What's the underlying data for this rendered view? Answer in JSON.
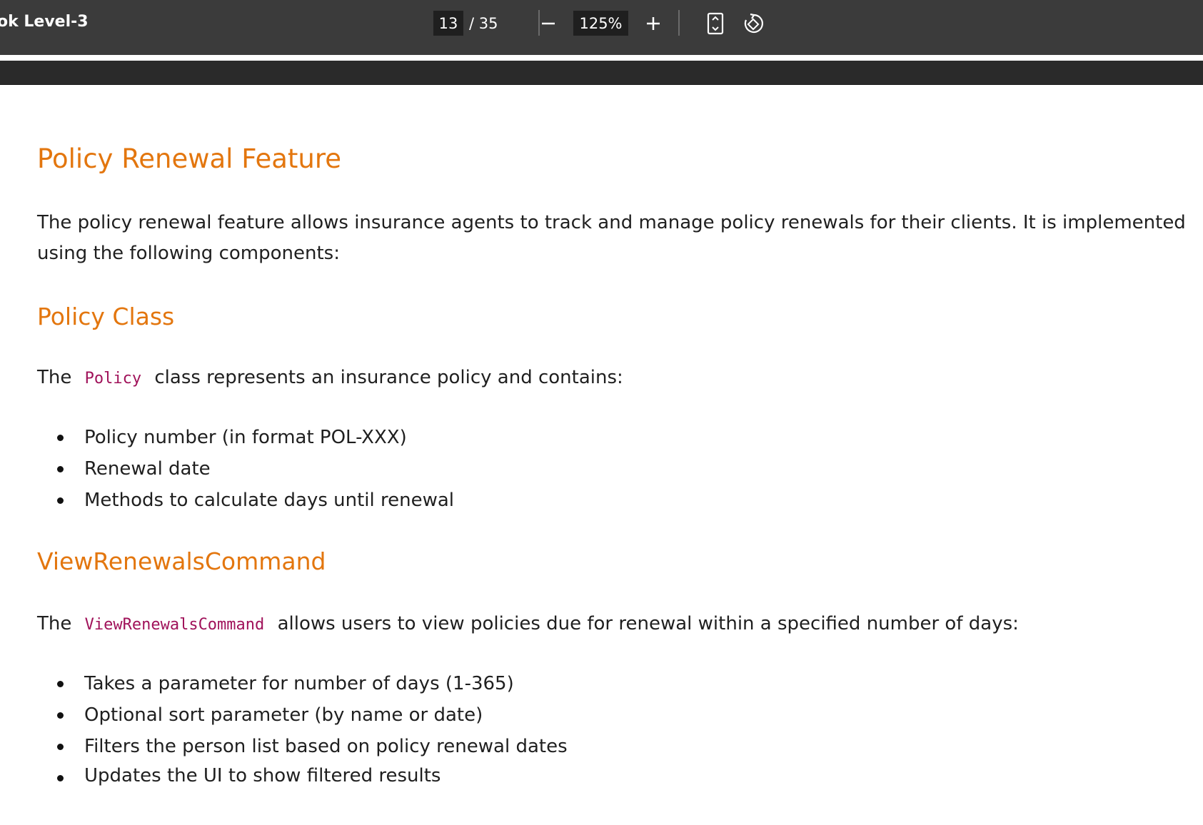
{
  "toolbar": {
    "title": "ok Level-3",
    "current_page": "13",
    "total_pages": "/ 35",
    "zoom": "125%",
    "icons": {
      "zoom_out": "minus-icon",
      "zoom_in": "plus-icon",
      "fit": "fit-page-icon",
      "rotate": "rotate-icon"
    }
  },
  "document": {
    "heading": "Policy Renewal Feature",
    "intro_line1": "The policy renewal feature allows insurance agents to track and manage policy renewals for their clients. It is implemented",
    "intro_line2": "using the following components:",
    "policy_section": {
      "heading": "Policy Class",
      "text_before": "The",
      "code": "Policy",
      "text_after": "class represents an insurance policy and contains:",
      "items": [
        "Policy number (in format POL-XXX)",
        "Renewal date",
        "Methods to calculate days until renewal"
      ]
    },
    "command_section": {
      "heading": "ViewRenewalsCommand",
      "text_before": "The",
      "code": "ViewRenewalsCommand",
      "text_after": "allows users to view policies due for renewal within a specified number of days:",
      "items": [
        "Takes a parameter for number of days (1-365)",
        "Optional sort parameter (by name or date)",
        "Filters the person list based on policy renewal dates",
        "Updates the UI to show filtered results"
      ]
    }
  },
  "colors": {
    "heading": "#e3760e",
    "code": "#a0125a",
    "toolbar": "#3b3b3b"
  }
}
